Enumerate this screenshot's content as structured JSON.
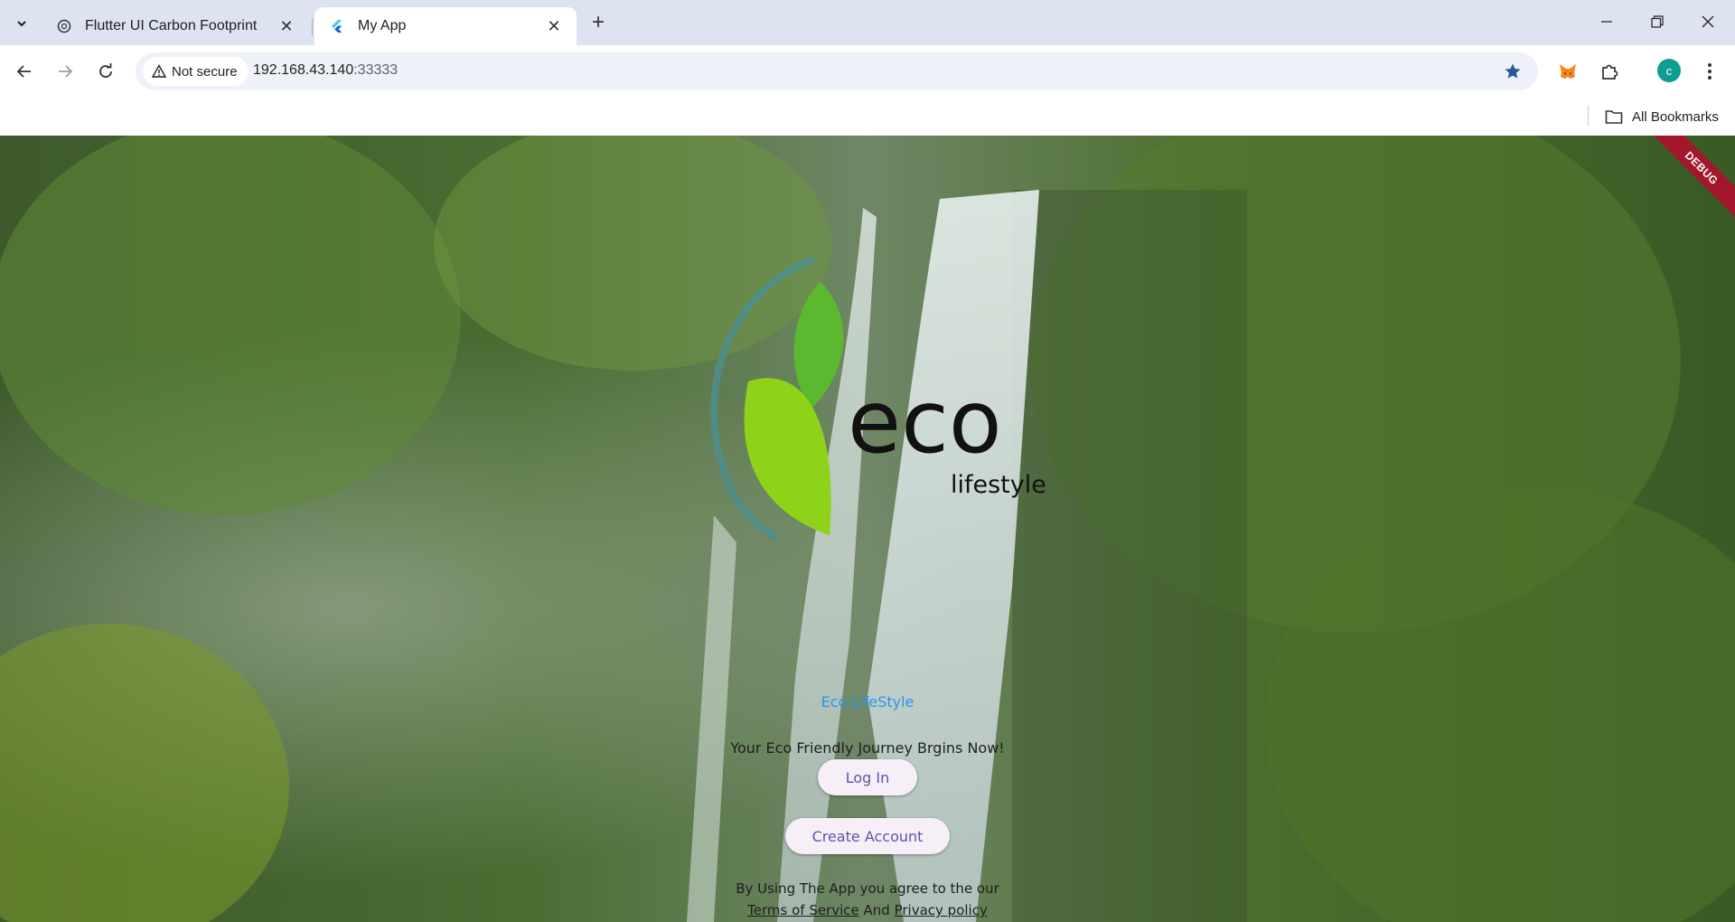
{
  "browser": {
    "tabs": [
      {
        "title": "Flutter UI Carbon Footprint",
        "icon": "openai-icon",
        "active": false
      },
      {
        "title": "My App",
        "icon": "flutter-icon",
        "active": true
      }
    ],
    "security_label": "Not secure",
    "url_host": "192.168.43.140",
    "url_port": ":33333",
    "profile_initial": "c",
    "bookmarks_label": "All Bookmarks"
  },
  "app": {
    "debug_label": "DEBUG",
    "logo": {
      "word": "eco",
      "subword": "lifestyle"
    },
    "title": "Eco LifeStyle",
    "tagline": "Your Eco Friendly Journey Brgins Now!",
    "login_label": "Log In",
    "create_label": "Create Account",
    "terms_line1": "By Using The App you agree to the our",
    "terms_link1": "Terms of Service",
    "terms_and": " And ",
    "terms_link2": "Privacy policy"
  },
  "colors": {
    "accent_blue": "#2196f3",
    "button_text": "#6750a4",
    "button_bg": "#f6eff8",
    "debug_banner": "#a3172c",
    "leaf_light": "#8fd21a",
    "leaf_dark": "#5cb82e",
    "arc": "#4f8e8a"
  }
}
